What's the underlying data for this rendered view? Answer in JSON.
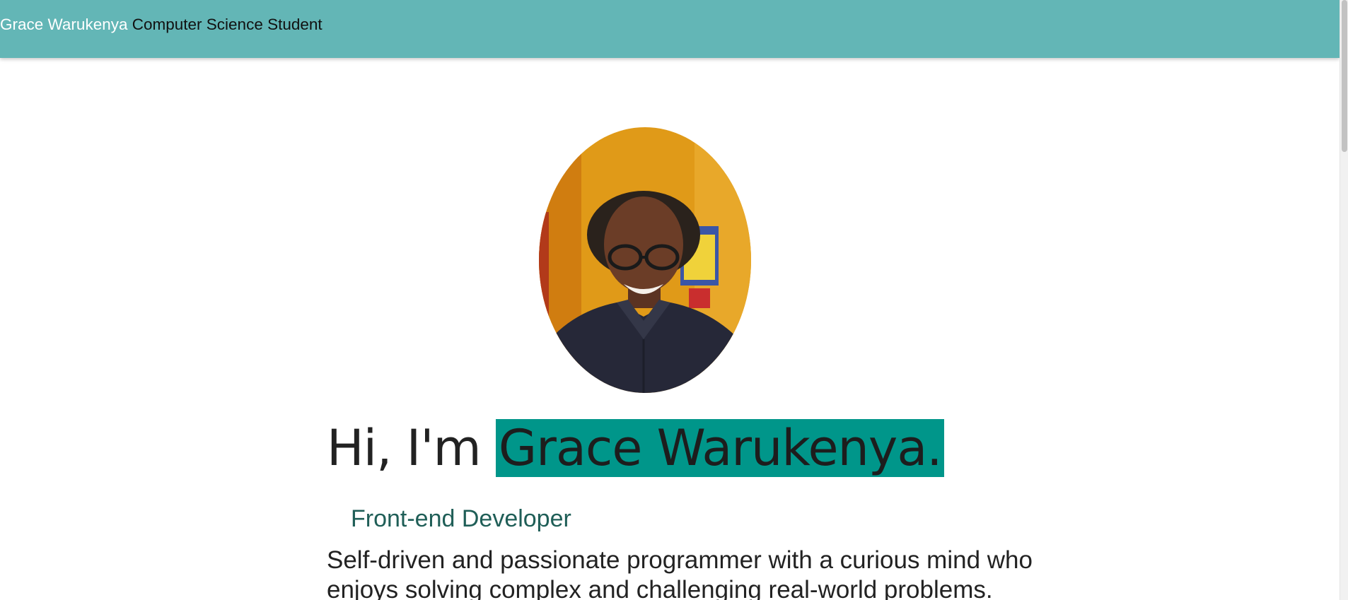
{
  "navbar": {
    "brand_name": "Grace Warukenya",
    "brand_title": "Computer Science Student"
  },
  "hero": {
    "greeting_prefix": "Hi, I'm ",
    "greeting_name": "Grace Warukenya.",
    "role": "Front-end Developer",
    "bio": "Self-driven and passionate programmer with a curious mind who enjoys solving complex and challenging real-world problems."
  },
  "colors": {
    "navbar_bg": "#63b6b6",
    "highlight": "#00968a",
    "role_text": "#1f5e57"
  }
}
